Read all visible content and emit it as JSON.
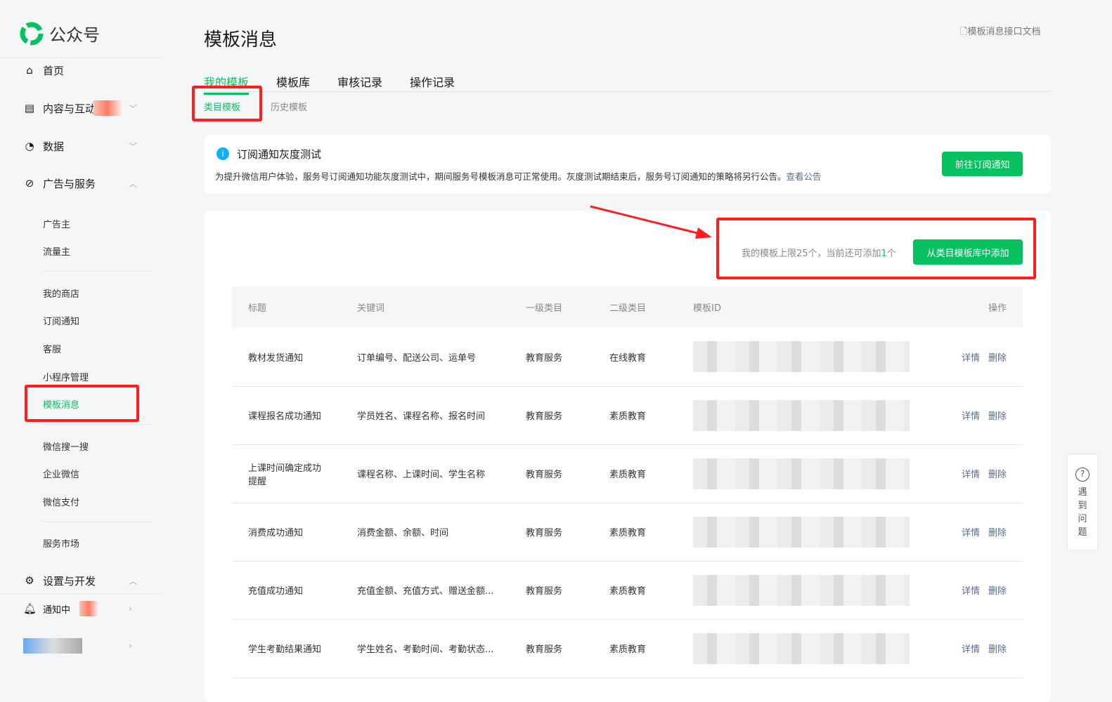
{
  "app": {
    "name": "公众号"
  },
  "sidebar": {
    "home": "首页",
    "content": "内容与互动",
    "data": "数据",
    "ads": "广告与服务",
    "ads_items": [
      "广告主",
      "流量主"
    ],
    "services": [
      "我的商店",
      "订阅通知",
      "客服",
      "小程序管理",
      "模板消息"
    ],
    "more": [
      "微信搜一搜",
      "企业微信",
      "微信支付"
    ],
    "market": "服务市场",
    "settings": "设置与开发",
    "notify": "通知中"
  },
  "page": {
    "title": "模板消息",
    "doc_link": "模板消息接口文档",
    "tabs": [
      "我的模板",
      "模板库",
      "审核记录",
      "操作记录"
    ],
    "subtabs": [
      "类目模板",
      "历史模板"
    ]
  },
  "notice": {
    "title": "订阅通知灰度测试",
    "body": "为提升微信用户体验，服务号订阅通知功能灰度测试中，期间服务号模板消息可正常使用。灰度测试期结束后，服务号订阅通知的策略将另行公告。",
    "link": "查看公告",
    "button": "前往订阅通知"
  },
  "quota": {
    "text_prefix": "我的模板上限25个，当前还可添加",
    "remaining": "1",
    "text_suffix": "个",
    "button": "从类目模板库中添加"
  },
  "table": {
    "headers": [
      "标题",
      "关键词",
      "一级类目",
      "二级类目",
      "模板ID",
      "操作"
    ],
    "rows": [
      {
        "title": "教材发货通知",
        "keywords": "订单编号、配送公司、运单号",
        "cat1": "教育服务",
        "cat2": "在线教育"
      },
      {
        "title": "课程报名成功通知",
        "keywords": "学员姓名、课程名称、报名时间",
        "cat1": "教育服务",
        "cat2": "素质教育"
      },
      {
        "title": "上课时间确定成功提醒",
        "keywords": "课程名称、上课时间、学生名称",
        "cat1": "教育服务",
        "cat2": "素质教育"
      },
      {
        "title": "消费成功通知",
        "keywords": "消费金额、余额、时间",
        "cat1": "教育服务",
        "cat2": "素质教育"
      },
      {
        "title": "充值成功通知",
        "keywords": "充值金额、充值方式、赠送金额...",
        "cat1": "教育服务",
        "cat2": "素质教育"
      },
      {
        "title": "学生考勤结果通知",
        "keywords": "学生姓名、考勤时间、考勤状态...",
        "cat1": "教育服务",
        "cat2": "素质教育"
      }
    ],
    "detail": "详情",
    "delete": "删除"
  },
  "help": {
    "label": "遇到问题"
  }
}
